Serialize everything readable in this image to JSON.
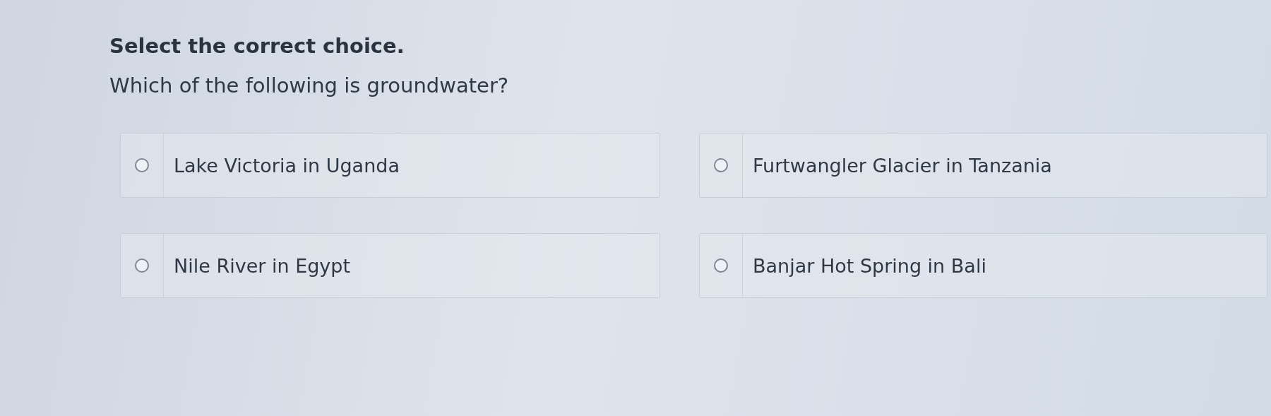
{
  "instruction": "Select the correct choice.",
  "question": "Which of the following is groundwater?",
  "choices": [
    {
      "label": "Lake Victoria in Uganda",
      "selected": false
    },
    {
      "label": "Furtwangler Glacier in Tanzania",
      "selected": false
    },
    {
      "label": "Nile River in Egypt",
      "selected": false
    },
    {
      "label": "Banjar Hot Spring in Bali",
      "selected": false
    }
  ]
}
